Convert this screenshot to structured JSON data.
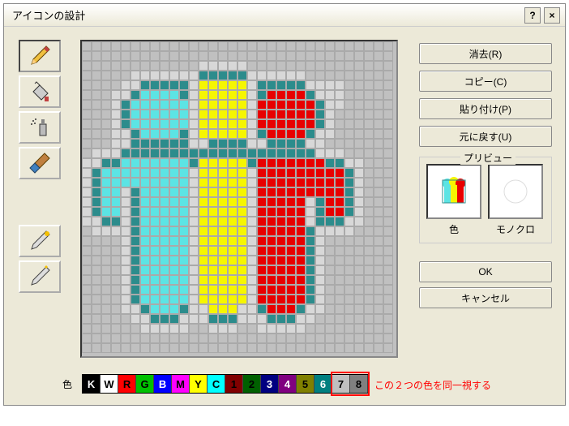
{
  "window": {
    "title": "アイコンの設計"
  },
  "titlebar_buttons": {
    "help": "?",
    "close": "×"
  },
  "tools": {
    "pencil": "pencil-icon",
    "fill": "fill-icon",
    "spray": "spray-icon",
    "brush": "brush-icon",
    "wand1": "wand1-icon",
    "wand2": "wand2-icon"
  },
  "buttons": {
    "clear": "消去(R)",
    "copy": "コピー(C)",
    "paste": "貼り付け(P)",
    "undo": "元に戻す(U)",
    "ok": "OK",
    "cancel": "キャンセル"
  },
  "preview": {
    "legend": "プリビュー",
    "color_label": "色",
    "mono_label": "モノクロ"
  },
  "palette": {
    "label": "色",
    "swatches": [
      {
        "letter": "K",
        "bg": "#000000",
        "fg": "#ffffff"
      },
      {
        "letter": "W",
        "bg": "#ffffff",
        "fg": "#000000"
      },
      {
        "letter": "R",
        "bg": "#ff0000",
        "fg": "#000000"
      },
      {
        "letter": "G",
        "bg": "#00c000",
        "fg": "#000000"
      },
      {
        "letter": "B",
        "bg": "#0000ff",
        "fg": "#ffffff"
      },
      {
        "letter": "M",
        "bg": "#ff00ff",
        "fg": "#000000"
      },
      {
        "letter": "Y",
        "bg": "#ffff00",
        "fg": "#000000"
      },
      {
        "letter": "C",
        "bg": "#00ffff",
        "fg": "#000000"
      },
      {
        "letter": "1",
        "bg": "#800000",
        "fg": "#000000"
      },
      {
        "letter": "2",
        "bg": "#006000",
        "fg": "#000000"
      },
      {
        "letter": "3",
        "bg": "#000080",
        "fg": "#ffffff"
      },
      {
        "letter": "4",
        "bg": "#800080",
        "fg": "#ffffff"
      },
      {
        "letter": "5",
        "bg": "#808000",
        "fg": "#000000"
      },
      {
        "letter": "6",
        "bg": "#008080",
        "fg": "#ffffff"
      },
      {
        "letter": "7",
        "bg": "#c0c0c0",
        "fg": "#000000"
      },
      {
        "letter": "8",
        "bg": "#808080",
        "fg": "#000000"
      }
    ]
  },
  "annotation": "この２つの色を同一視する",
  "highlight": {
    "start": 14,
    "end": 15
  },
  "colors": {
    "teal": "#2c8c8c",
    "cyan": "#5ce4e4",
    "yellow": "#f6f600",
    "red": "#e80000",
    "lightgray": "#d8d8d8",
    "bg": "#c0c0c0"
  },
  "pixel_art": [
    "................................",
    "................................",
    "............77777...............",
    ".....777777766666777777.........",
    "....77666667YYYYY7666667777.....",
    "...776CCCC67YYYYY76RRRR6777.....",
    "...76CCCCCC7YYYYY7RRRRRR677.....",
    "...76CCCCCC7YYYYY7RRRRRR67......",
    "...76CCCCCC7YYYYY7RRRRRR67......",
    "...776CCCC67YYYYY76RRRR677......",
    "...7766666677666677666677.......",
    ".77766666666666666666666777.....",
    "7766CCCCCCC6YYYYY6RRRRRRR6677...",
    "76CCCCCCCCC7YYYYY7RRRRRRRRR67...",
    "76CCCCCCCCC7YYYYY7RRRRRRRRR67...",
    "76CC76CCCCC7YYYYY7RRRRRRRRR67...",
    "76CC76CCCCC7YYYYY7RRRRR76RR67...",
    "76CC76CCCCC7YYYYY7RRRRR76RR67...",
    "776676CCCCC7YYYYY7RRRRR766677...",
    ".77776CCCCC7YYYYY7RRRRR67777....",
    "....76CCCCC7YYYYY7RRRRR67.......",
    "....76CCCCC7YYYYY7RRRRR67.......",
    "....76CCCCC7YYYYY7RRRRR67.......",
    "....76CCCCC7YYYYY7RRRRR67.......",
    "....76CCCCC7YYYYY7RRRRR67.......",
    "....76CCCCC7YYYYY7RRRRR67.......",
    "....76CCCCC7YYYYY7RRRRR67.......",
    "....776CCC677YYY776RRR677.......",
    ".....7766677766677766677........",
    "......77777..777..77777.........",
    "................................",
    "................................"
  ]
}
